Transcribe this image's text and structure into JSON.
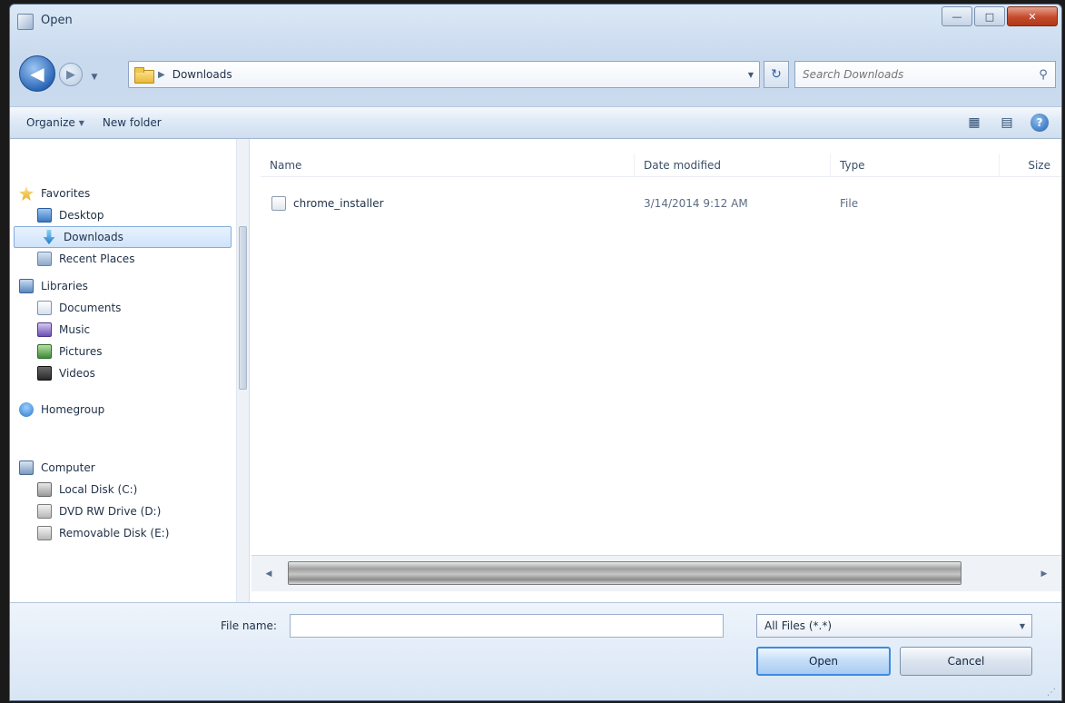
{
  "window": {
    "title": "Open",
    "minimize_glyph": "—",
    "maximize_glyph": "□",
    "close_glyph": "✕"
  },
  "nav": {
    "back_glyph": "◀",
    "forward_glyph": "▶",
    "history_glyph": "▼",
    "address_path": "Downloads",
    "address_separator": "▶",
    "refresh_glyph": "↻",
    "search_placeholder": "Search Downloads",
    "search_icon": "search-icon"
  },
  "toolbar": {
    "organize_label": "Organize",
    "newfolder_label": "New folder",
    "views_glyph": "▦",
    "preview_glyph": "▤",
    "help_glyph": "?"
  },
  "sidebar": {
    "favorites": {
      "label": "Favorites",
      "items": [
        {
          "label": "Desktop"
        },
        {
          "label": "Downloads"
        },
        {
          "label": "Recent Places"
        }
      ]
    },
    "libraries": {
      "label": "Libraries",
      "items": [
        {
          "label": "Documents"
        },
        {
          "label": "Music"
        },
        {
          "label": "Pictures"
        },
        {
          "label": "Videos"
        }
      ]
    },
    "homegroup": {
      "label": "Homegroup"
    },
    "computer": {
      "label": "Computer",
      "items": [
        {
          "label": "Local Disk (C:)"
        },
        {
          "label": "DVD RW Drive (D:)"
        },
        {
          "label": "Removable Disk (E:)"
        }
      ]
    }
  },
  "files": {
    "columns": {
      "name": "Name",
      "date": "Date modified",
      "type": "Type",
      "size": "Size"
    },
    "rows": [
      {
        "name": "chrome_installer",
        "date": "3/14/2014 9:12 AM",
        "type": "File",
        "size": ""
      }
    ]
  },
  "footer": {
    "filename_label": "File name:",
    "filename_value": "",
    "filetype_value": "All Files (*.*)",
    "open_label": "Open",
    "cancel_label": "Cancel"
  }
}
